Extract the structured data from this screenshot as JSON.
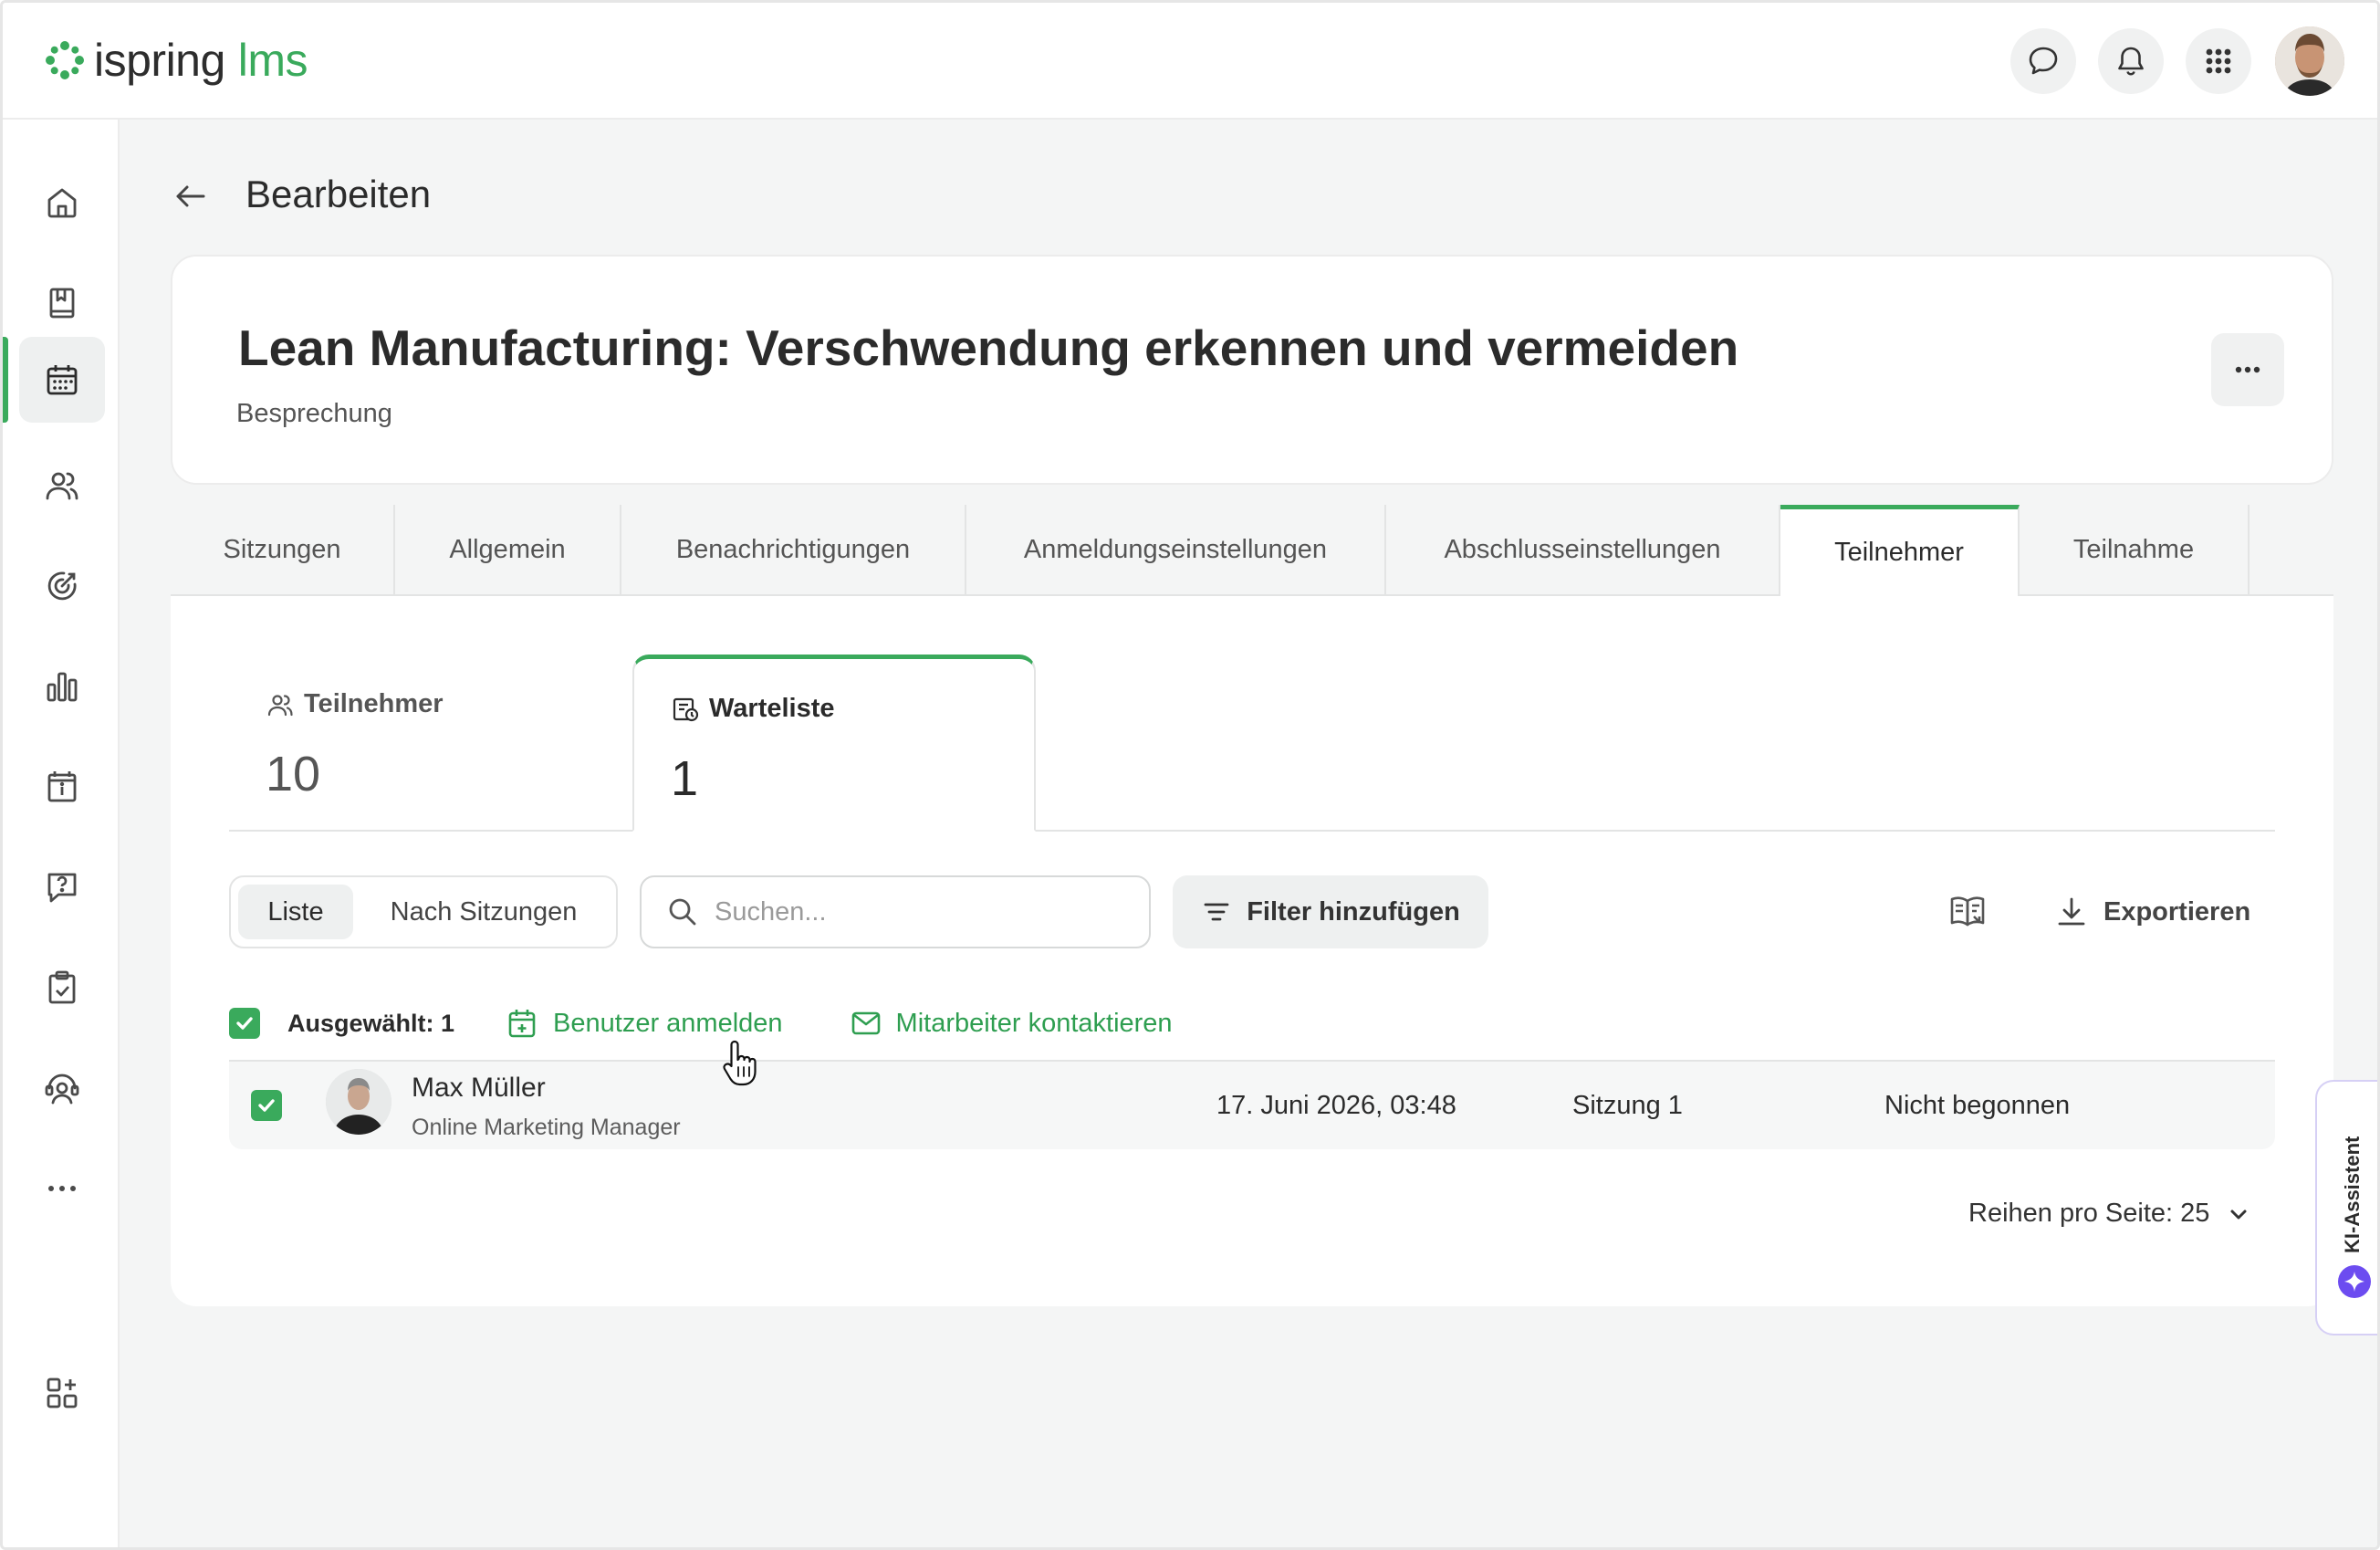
{
  "app": {
    "logo_name": "ispring",
    "logo_suffix": "lms",
    "brand_color": "#3aaa5c"
  },
  "topbar": {
    "icons": [
      "chat-icon",
      "bell-icon",
      "apps-grid-icon",
      "user-avatar"
    ]
  },
  "sidebar": {
    "items": [
      "home-icon",
      "courses-icon",
      "calendar-icon",
      "users-icon",
      "target-icon",
      "reports-icon",
      "info-board-icon",
      "help-chat-icon",
      "clipboard-check-icon",
      "support-icon",
      "more-icon",
      "add-widget-icon"
    ],
    "active": "calendar-icon"
  },
  "page": {
    "title": "Bearbeiten"
  },
  "course": {
    "title": "Lean Manufacturing: Verschwendung erkennen und vermeiden",
    "type": "Besprechung"
  },
  "tabs": [
    {
      "label": "Sitzungen"
    },
    {
      "label": "Allgemein"
    },
    {
      "label": "Benachrichtigungen"
    },
    {
      "label": "Anmeldungseinstellungen"
    },
    {
      "label": "Abschlusseinstellungen"
    },
    {
      "label": "Teilnehmer"
    },
    {
      "label": "Teilnahme"
    }
  ],
  "active_tab": "Teilnehmer",
  "stats": {
    "participants_label": "Teilnehmer",
    "participants_value": "10",
    "waitlist_label": "Warteliste",
    "waitlist_value": "1"
  },
  "toolbar": {
    "view_list": "Liste",
    "view_sessions": "Nach Sitzungen",
    "search_placeholder": "Suchen...",
    "filter_label": "Filter hinzufügen",
    "export_label": "Exportieren"
  },
  "selection": {
    "selected_label": "Ausgewählt: 1",
    "enroll_label": "Benutzer anmelden",
    "contact_label": "Mitarbeiter kontaktieren"
  },
  "rows": [
    {
      "name": "Max Müller",
      "role": "Online Marketing Manager",
      "date": "17. Juni 2026, 03:48",
      "session": "Sitzung 1",
      "status": "Nicht begonnen",
      "checked": true
    }
  ],
  "pagination": {
    "rows_per_page": "Reihen pro Seite: 25"
  },
  "ai_assistant": {
    "label": "KI-Assistent",
    "accent": "#6c4cf0"
  }
}
